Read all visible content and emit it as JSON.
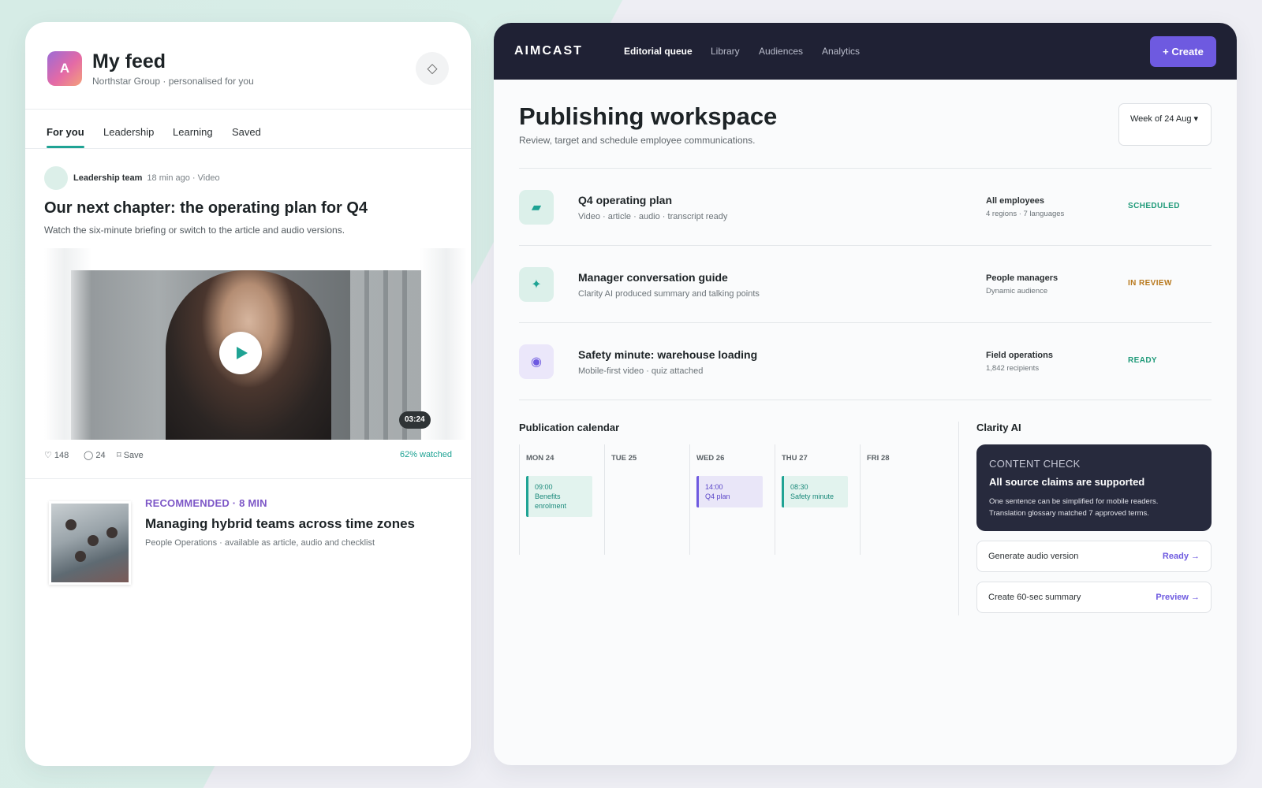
{
  "feed": {
    "avatar_letter": "A",
    "title": "My feed",
    "subtitle": "Northstar Group · personalised for you",
    "icon": "diamond-icon",
    "tabs": [
      {
        "label": "For you",
        "active": true
      },
      {
        "label": "Leadership",
        "active": false
      },
      {
        "label": "Learning",
        "active": false
      },
      {
        "label": "Saved",
        "active": false
      }
    ],
    "post": {
      "author": "Leadership team",
      "meta": "18 min ago · Video",
      "title": "Our next chapter: the operating plan for Q4",
      "description": "Watch the six-minute briefing or switch to the article and audio versions.",
      "duration": "03:24",
      "likes": "♡ 148",
      "comments": "◯ 24",
      "save": "⌑ Save",
      "watched": "62% watched"
    },
    "recommended": {
      "kicker": "RECOMMENDED · 8 MIN",
      "title": "Managing hybrid teams across time zones",
      "subtitle": "People Operations · available as article, audio and checklist"
    }
  },
  "workspace": {
    "brand": "AIMCAST",
    "nav": [
      {
        "label": "Editorial queue",
        "active": true
      },
      {
        "label": "Library",
        "active": false
      },
      {
        "label": "Audiences",
        "active": false
      },
      {
        "label": "Analytics",
        "active": false
      }
    ],
    "create_label": "+ Create",
    "title": "Publishing workspace",
    "subtitle": "Review, target and schedule employee communications.",
    "week_label": "Week of 24 Aug ▾",
    "queue": [
      {
        "icon": "tag-icon",
        "glyph": "▰",
        "icon_bg": "#dcf0ea",
        "icon_color": "#1fa394",
        "title": "Q4 operating plan",
        "subtitle": "Video · article · audio · transcript ready",
        "audience": "All employees",
        "audience_detail": "4 regions · 7 languages",
        "status": "SCHEDULED",
        "status_color": "#1f9a79"
      },
      {
        "icon": "sparkle-icon",
        "glyph": "✦",
        "icon_bg": "#dcf0ea",
        "icon_color": "#1fa394",
        "title": "Manager conversation guide",
        "subtitle": "Clarity AI produced summary and talking points",
        "audience": "People managers",
        "audience_detail": "Dynamic audience",
        "status": "IN REVIEW",
        "status_color": "#b8791e"
      },
      {
        "icon": "record-icon",
        "glyph": "◉",
        "icon_bg": "#ebe7fa",
        "icon_color": "#6e5ae0",
        "title": "Safety minute: warehouse loading",
        "subtitle": "Mobile-first video · quiz attached",
        "audience": "Field operations",
        "audience_detail": "1,842 recipients",
        "status": "READY",
        "status_color": "#1f9a79"
      }
    ],
    "calendar": {
      "title": "Publication calendar",
      "days": [
        {
          "label": "MON 24",
          "event": {
            "time": "09:00",
            "name": "Benefits enrolment",
            "bg": "#e2f3ee",
            "bar": "#1fa394",
            "color": "#1b8a7b"
          }
        },
        {
          "label": "TUE 25",
          "event": null
        },
        {
          "label": "WED 26",
          "event": {
            "time": "14:00",
            "name": "Q4 plan",
            "bg": "#e9e6f8",
            "bar": "#6e5ae0",
            "color": "#5a46c8"
          }
        },
        {
          "label": "THU 27",
          "event": {
            "time": "08:30",
            "name": "Safety minute",
            "bg": "#e2f3ee",
            "bar": "#1fa394",
            "color": "#1b8a7b"
          }
        },
        {
          "label": "FRI 28",
          "event": null
        }
      ]
    },
    "clarity": {
      "title": "Clarity AI",
      "kicker": "CONTENT CHECK",
      "headline": "All source claims are supported",
      "body_line1": "One sentence can be simplified for mobile readers.",
      "body_line2": "Translation glossary matched 7 approved terms.",
      "actions": [
        {
          "label": "Generate audio version",
          "link": "Ready →"
        },
        {
          "label": "Create 60-sec summary",
          "link": "Preview →"
        }
      ]
    }
  }
}
